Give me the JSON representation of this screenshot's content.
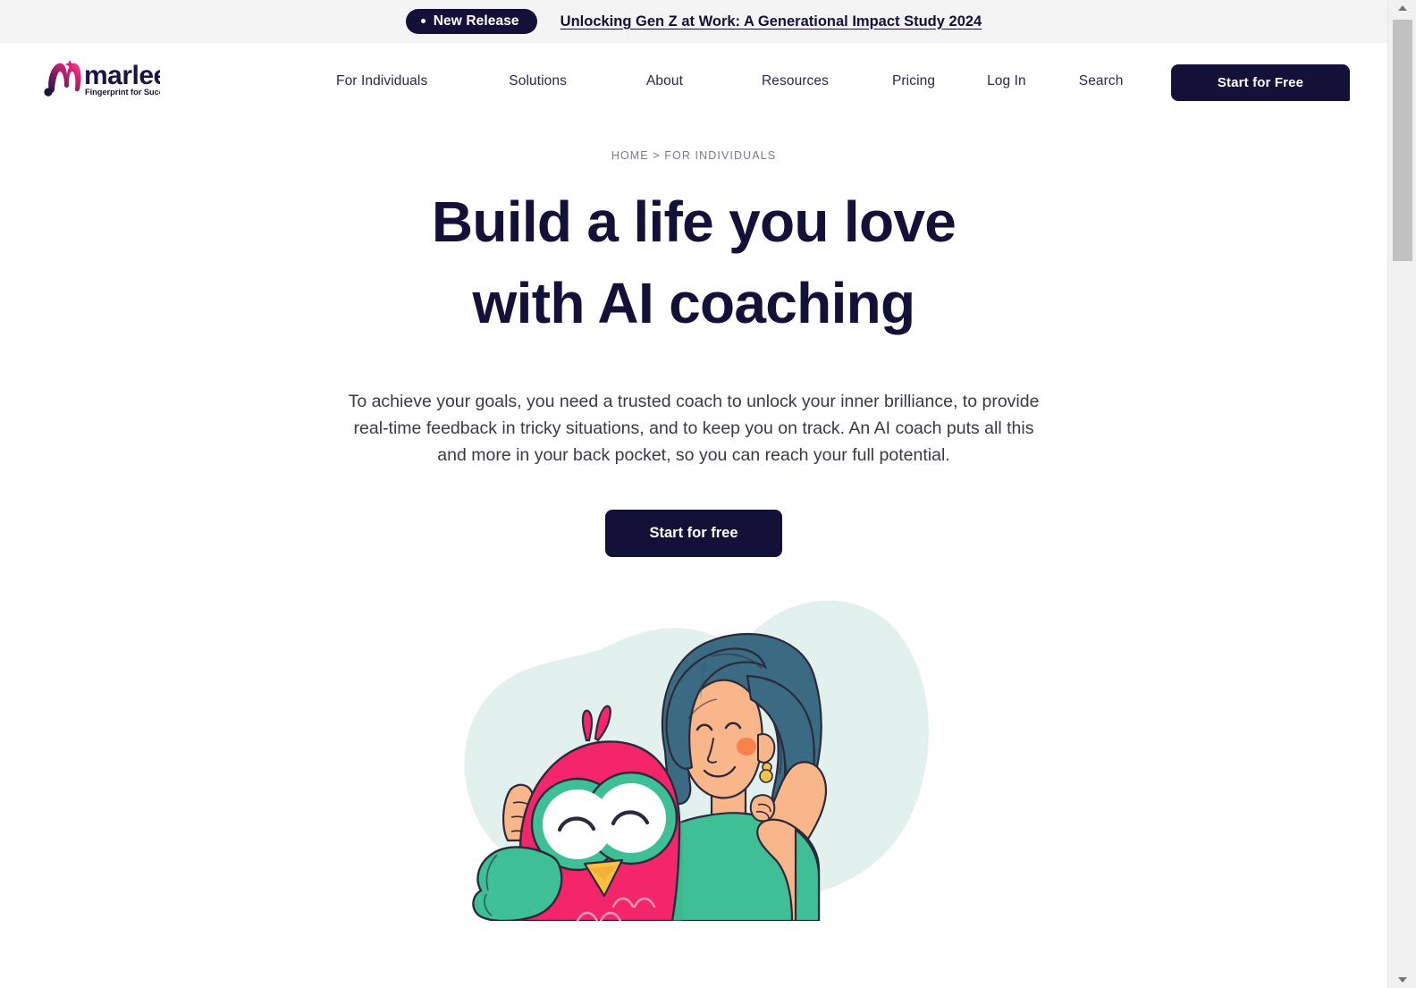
{
  "announcement": {
    "badge_label": "New Release",
    "badge_dot": "bullet-dot",
    "link_text": "Unlocking Gen Z at Work: A Generational Impact Study 2024"
  },
  "header": {
    "logo": {
      "wordmark": "marlee",
      "tagline": "Fingerprint for Success"
    },
    "nav_items": [
      {
        "label": "For Individuals"
      },
      {
        "label": "Solutions"
      },
      {
        "label": "About"
      },
      {
        "label": "Resources"
      },
      {
        "label": "Pricing"
      },
      {
        "label": "Log In"
      },
      {
        "label": "Search"
      }
    ],
    "cta_label": "Start for Free"
  },
  "hero": {
    "breadcrumb": "HOME > FOR INDIVIDUALS",
    "title_line1": "Build a life you love",
    "title_line2": "with AI coaching",
    "subtitle": "To achieve your goals, you need a trusted coach to unlock your inner brilliance, to provide real-time feedback in tricky situations, and to keep you on track. An AI coach puts all this and more in your back pocket, so you can reach your full potential.",
    "cta_label": "Start for free",
    "illustration_name": "woman-with-owl-mascot-illustration"
  },
  "colors": {
    "ink": "#141138",
    "announce_bg": "#f4f4f5",
    "body_text": "#3a3a44",
    "breadcrumb_text": "#7b7b86",
    "blob_mint": "#e2f1ee",
    "skin": "#f9b68a",
    "hair": "#3a6b83",
    "shirt_green": "#3fbf95",
    "bird_pink": "#f4256b",
    "beak_gold": "#f8c23c",
    "earring_gold": "#f2c34a",
    "blush": "#f4773d",
    "logo_magenta": "#e2237a",
    "logo_navy": "#1b1340",
    "outline": "#2b2a3d"
  },
  "scrollbar": {
    "up_arrow": "caret-up-icon",
    "down_arrow": "caret-down-icon"
  }
}
